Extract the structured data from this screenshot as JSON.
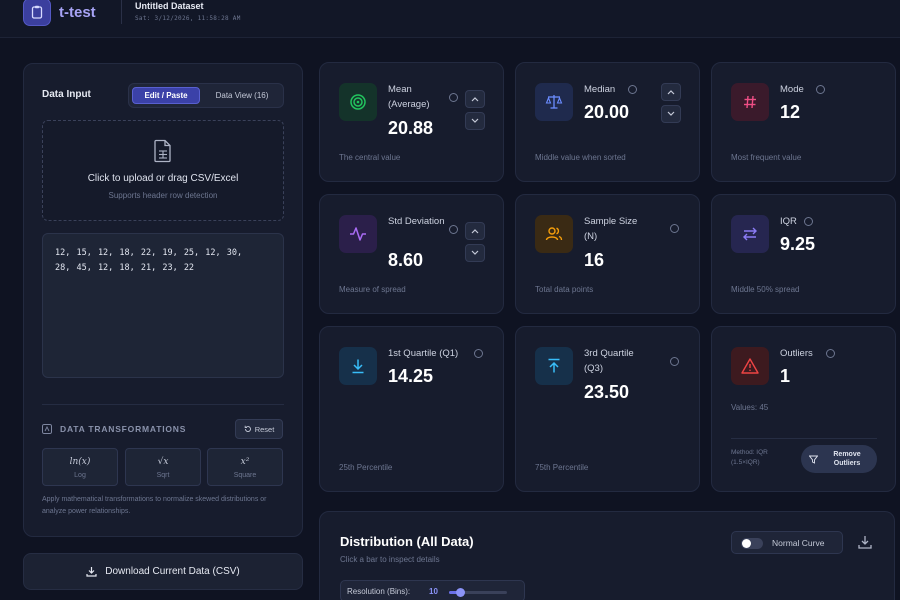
{
  "header": {
    "app_name": "t-test",
    "dataset_title": "Untitled Dataset",
    "dataset_date": "Sat: 3/12/2026, 11:58:28 AM"
  },
  "data_input": {
    "title": "Data Input",
    "tabs": [
      {
        "label": "Edit / Paste",
        "active": true
      },
      {
        "label": "Data View (16)",
        "active": false
      }
    ],
    "upload_title": "Click to upload or drag CSV/Excel",
    "upload_subtitle": "Supports header row detection",
    "raw_data": "12, 15, 12, 18, 22, 19, 25, 12, 30,\n28, 45, 12, 18, 21, 23, 22",
    "transformations_title": "DATA TRANSFORMATIONS",
    "reset_label": "Reset",
    "transforms": [
      {
        "formula": "ln(x)",
        "label": "Log"
      },
      {
        "formula": "√x",
        "label": "Sqrt"
      },
      {
        "formula": "x²",
        "label": "Square"
      }
    ],
    "transform_note": "Apply mathematical transformations to normalize skewed distributions or analyze power relationships."
  },
  "download_label": "Download Current Data (CSV)",
  "stats": {
    "mean": {
      "label": "Mean (Average)",
      "value": "20.88",
      "desc": "The central value",
      "icon": "target-icon",
      "color": "#22c55e"
    },
    "median": {
      "label": "Median",
      "value": "20.00",
      "desc": "Middle value when sorted",
      "icon": "scale-icon",
      "color": "#6b8cff"
    },
    "mode": {
      "label": "Mode",
      "value": "12",
      "desc": "Most frequent value",
      "icon": "hash-icon",
      "color": "#ef4f86"
    },
    "std": {
      "label": "Std Deviation",
      "value": "8.60",
      "desc": "Measure of spread",
      "icon": "activity-icon",
      "color": "#a96cf5"
    },
    "sample": {
      "label": "Sample Size (N)",
      "value": "16",
      "desc": "Total data points",
      "icon": "users-icon",
      "color": "#f59e0b"
    },
    "iqr": {
      "label": "IQR",
      "value": "9.25",
      "desc": "Middle 50% spread",
      "icon": "arrows-lr-icon",
      "color": "#8b7cf6"
    },
    "q1": {
      "label": "1st Quartile (Q1)",
      "value": "14.25",
      "desc": "25th Percentile",
      "icon": "arrow-down-icon",
      "color": "#38bdf8"
    },
    "q3": {
      "label": "3rd Quartile (Q3)",
      "value": "23.50",
      "desc": "75th Percentile",
      "icon": "arrow-up-icon",
      "color": "#38bdf8"
    },
    "outliers": {
      "label": "Outliers",
      "value": "1",
      "values_text": "Values: 45",
      "method": "Method: IQR (1.5×IQR)",
      "remove_label": "Remove Outliers",
      "icon": "alert-triangle-icon",
      "color": "#ef4444"
    }
  },
  "distribution": {
    "title": "Distribution (All Data)",
    "subtitle": "Click a bar to inspect details",
    "normal_curve_label": "Normal Curve",
    "normal_curve_on": false,
    "resolution_label": "Resolution (Bins):",
    "resolution_value": "10",
    "resolution_fraction": 0.2
  },
  "colors": {
    "accent": "#3b41a8",
    "background": "#0f1322",
    "panel": "#171c2d"
  }
}
